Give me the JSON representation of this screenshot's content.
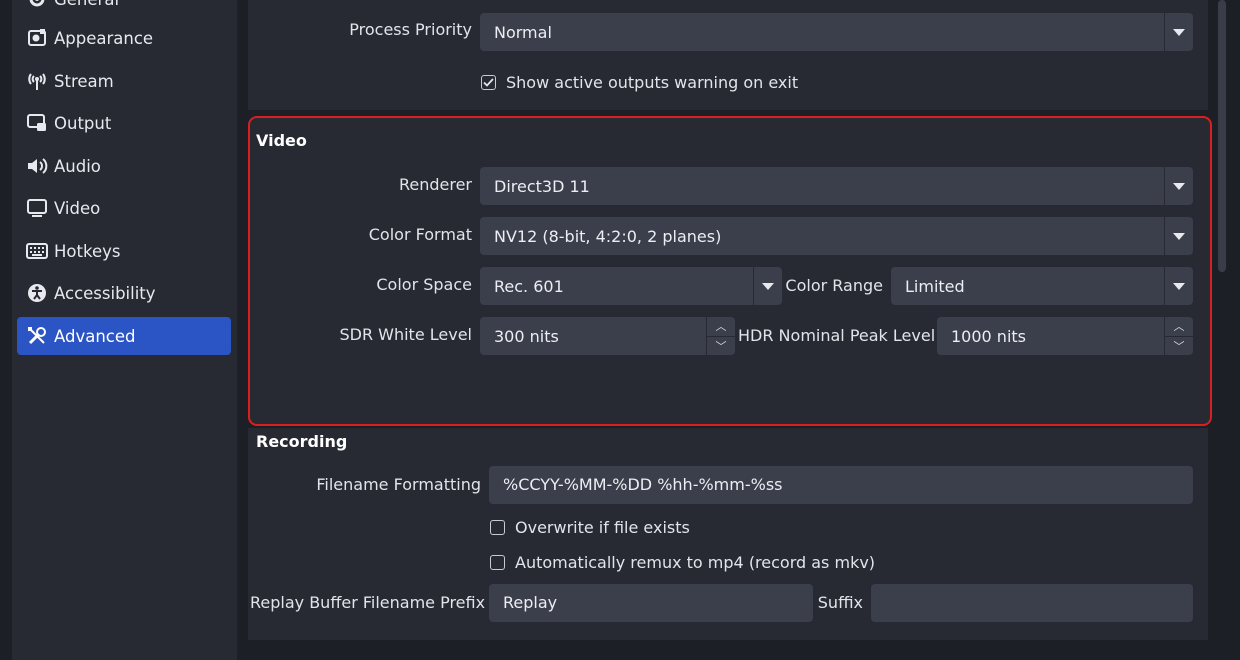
{
  "sidebar": {
    "items": [
      {
        "label": "General",
        "icon": "gear-icon"
      },
      {
        "label": "Appearance",
        "icon": "appearance-icon"
      },
      {
        "label": "Stream",
        "icon": "broadcast-icon"
      },
      {
        "label": "Output",
        "icon": "output-icon"
      },
      {
        "label": "Audio",
        "icon": "speaker-icon"
      },
      {
        "label": "Video",
        "icon": "monitor-icon"
      },
      {
        "label": "Hotkeys",
        "icon": "keyboard-icon"
      },
      {
        "label": "Accessibility",
        "icon": "accessibility-icon"
      },
      {
        "label": "Advanced",
        "icon": "tools-icon"
      }
    ],
    "active": "Advanced"
  },
  "general": {
    "process_priority_label": "Process Priority",
    "process_priority_value": "Normal",
    "show_warning_label": "Show active outputs warning on exit",
    "show_warning_checked": true
  },
  "video": {
    "title": "Video",
    "renderer_label": "Renderer",
    "renderer_value": "Direct3D 11",
    "color_format_label": "Color Format",
    "color_format_value": "NV12 (8-bit, 4:2:0, 2 planes)",
    "color_space_label": "Color Space",
    "color_space_value": "Rec. 601",
    "color_range_label": "Color Range",
    "color_range_value": "Limited",
    "sdr_white_label": "SDR White Level",
    "sdr_white_value": "300 nits",
    "hdr_peak_label": "HDR Nominal Peak Level",
    "hdr_peak_value": "1000 nits"
  },
  "recording": {
    "title": "Recording",
    "filename_label": "Filename Formatting",
    "filename_value": "%CCYY-%MM-%DD %hh-%mm-%ss",
    "overwrite_label": "Overwrite if file exists",
    "overwrite_checked": false,
    "remux_label": "Automatically remux to mp4 (record as mkv)",
    "remux_checked": false,
    "replay_prefix_label": "Replay Buffer Filename Prefix",
    "replay_prefix_value": "Replay",
    "suffix_label": "Suffix",
    "suffix_value": ""
  },
  "colors": {
    "accent": "#2b55c4",
    "highlight_border": "#d9201e",
    "panel": "#272a33",
    "input": "#3b3e4b"
  }
}
